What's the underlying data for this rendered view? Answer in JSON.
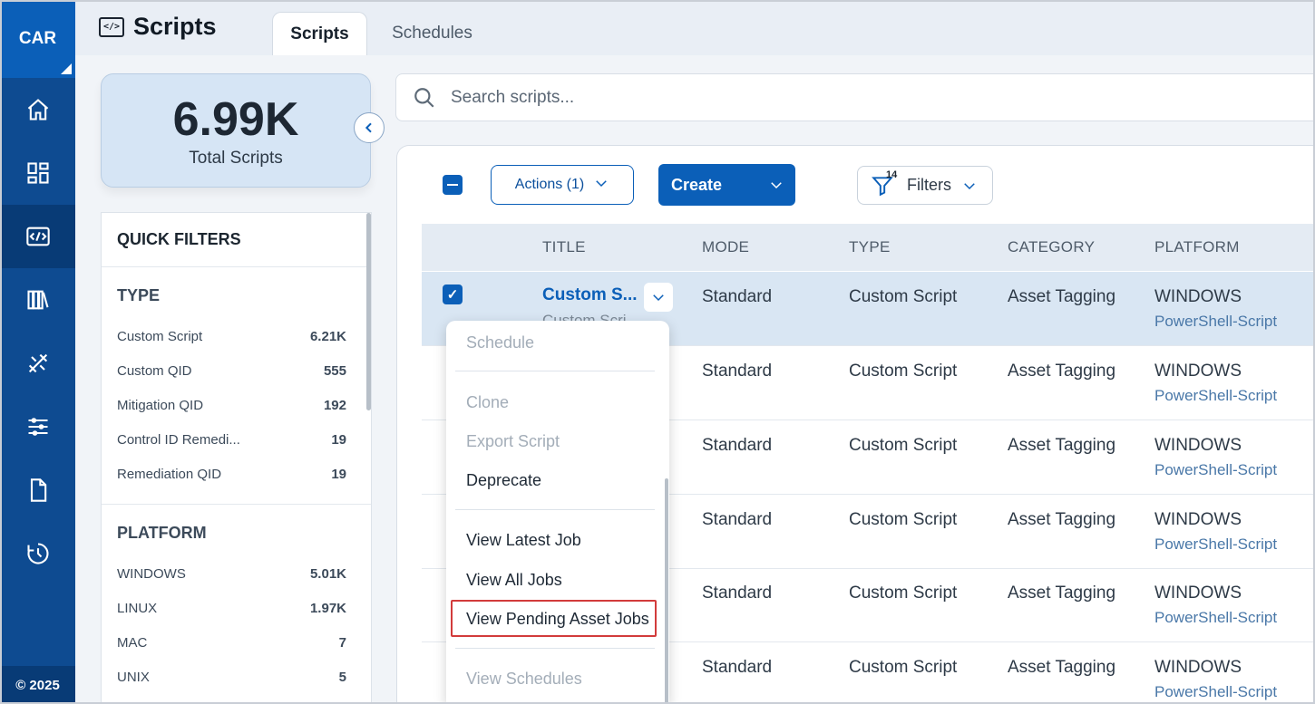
{
  "rail": {
    "brand": "CAR",
    "copyright": "© 2025",
    "items": [
      {
        "icon": "home-icon"
      },
      {
        "icon": "dashboard-icon"
      },
      {
        "icon": "scripts-icon",
        "active": true
      },
      {
        "icon": "library-icon"
      },
      {
        "icon": "tools-icon"
      },
      {
        "icon": "settings-sliders-icon"
      },
      {
        "icon": "document-icon"
      },
      {
        "icon": "history-icon"
      }
    ]
  },
  "header": {
    "title": "Scripts",
    "tabs": [
      {
        "label": "Scripts",
        "active": true
      },
      {
        "label": "Schedules",
        "active": false
      }
    ]
  },
  "stats": {
    "value": "6.99K",
    "label": "Total Scripts"
  },
  "quick_filters": {
    "title": "QUICK FILTERS",
    "sections": [
      {
        "title": "TYPE",
        "items": [
          {
            "label": "Custom Script",
            "count": "6.21K"
          },
          {
            "label": "Custom QID",
            "count": "555"
          },
          {
            "label": "Mitigation QID",
            "count": "192"
          },
          {
            "label": "Control ID Remedi...",
            "count": "19"
          },
          {
            "label": "Remediation QID",
            "count": "19"
          }
        ]
      },
      {
        "title": "PLATFORM",
        "items": [
          {
            "label": "WINDOWS",
            "count": "5.01K"
          },
          {
            "label": "LINUX",
            "count": "1.97K"
          },
          {
            "label": "MAC",
            "count": "7"
          },
          {
            "label": "UNIX",
            "count": "5"
          }
        ]
      }
    ]
  },
  "search": {
    "placeholder": "Search scripts..."
  },
  "toolbar": {
    "actions_label": "Actions (1)",
    "create_label": "Create",
    "filters_label": "Filters",
    "filters_badge": "14"
  },
  "table": {
    "headers": [
      "TITLE",
      "MODE",
      "TYPE",
      "CATEGORY",
      "PLATFORM"
    ],
    "rows": [
      {
        "title": "Custom S...",
        "title_sub": "Custom Scri",
        "mode": "Standard",
        "type": "Custom Script",
        "category": "Asset Tagging",
        "platform": "WINDOWS",
        "platform_sub": "PowerShell-Script",
        "selected": true
      },
      {
        "mode": "Standard",
        "type": "Custom Script",
        "category": "Asset Tagging",
        "platform": "WINDOWS",
        "platform_sub": "PowerShell-Script"
      },
      {
        "mode": "Standard",
        "type": "Custom Script",
        "category": "Asset Tagging",
        "platform": "WINDOWS",
        "platform_sub": "PowerShell-Script"
      },
      {
        "mode": "Standard",
        "type": "Custom Script",
        "category": "Asset Tagging",
        "platform": "WINDOWS",
        "platform_sub": "PowerShell-Script"
      },
      {
        "mode": "Standard",
        "type": "Custom Script",
        "category": "Asset Tagging",
        "platform": "WINDOWS",
        "platform_sub": "PowerShell-Script"
      },
      {
        "mode": "Standard",
        "type": "Custom Script",
        "category": "Asset Tagging",
        "platform": "WINDOWS",
        "platform_sub": "PowerShell-Script"
      }
    ]
  },
  "menu": {
    "items": [
      {
        "label": "Schedule",
        "disabled": true
      },
      {
        "label": "Clone",
        "disabled": true
      },
      {
        "label": "Export Script",
        "disabled": true
      },
      {
        "label": "Deprecate",
        "disabled": false
      },
      {
        "label": "View Latest Job",
        "disabled": false
      },
      {
        "label": "View All Jobs",
        "disabled": false
      },
      {
        "label": "View Pending Asset Jobs",
        "disabled": false,
        "highlighted": true
      },
      {
        "label": "View Schedules",
        "disabled": true
      }
    ]
  },
  "colors": {
    "primary": "#0b5fb8",
    "rail": "#0e4b91",
    "highlight_border": "#d23b3b"
  }
}
